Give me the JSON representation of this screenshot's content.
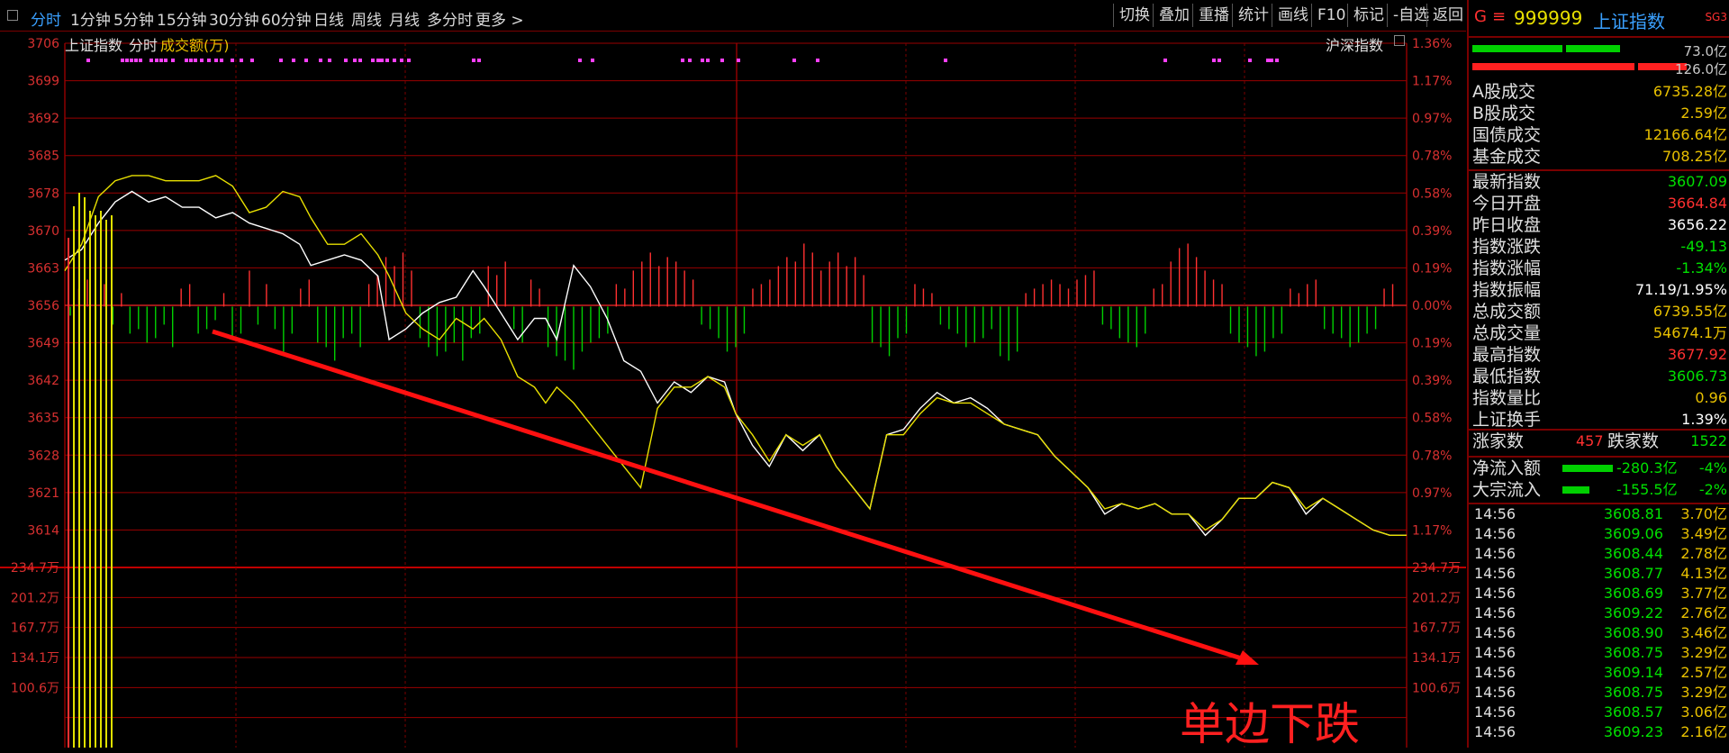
{
  "toolbar": {
    "periods": [
      "分时",
      "1分钟",
      "5分钟",
      "15分钟",
      "30分钟",
      "60分钟",
      "日线",
      "周线",
      "月线",
      "多分时",
      "更多 >"
    ],
    "right_buttons": [
      "切换",
      "叠加",
      "重播",
      "统计",
      "画线",
      "F10",
      "标记",
      "-自选",
      "返回"
    ]
  },
  "chart_header": {
    "name": "上证指数",
    "mode": "分时",
    "vol_label": "成交额(万)",
    "compare_label": "沪深指数"
  },
  "annotation": "单边下跌",
  "chart_data": {
    "type": "line",
    "left_ticks": [
      "3706",
      "3699",
      "3692",
      "3685",
      "3678",
      "3670",
      "3663",
      "3656",
      "3649",
      "3642",
      "3635",
      "3628",
      "3621",
      "3614"
    ],
    "right_ticks": [
      "1.36%",
      "1.17%",
      "0.97%",
      "0.78%",
      "0.58%",
      "0.39%",
      "0.19%",
      "0.00%",
      "0.19%",
      "0.39%",
      "0.58%",
      "0.78%",
      "0.97%",
      "1.17%"
    ],
    "vol_ticks_left": [
      "234.7万",
      "201.2万",
      "167.7万",
      "134.1万",
      "100.6万"
    ],
    "vol_ticks_right": [
      "234.7万",
      "201.2万",
      "167.7万",
      "134.1万",
      "100.6万"
    ],
    "ylim": [
      3612,
      3708
    ],
    "prev_close": 3656.22,
    "series": [
      {
        "color": "#ffffff",
        "points": [
          [
            0,
            3665
          ],
          [
            6,
            3667
          ],
          [
            12,
            3672
          ],
          [
            18,
            3676
          ],
          [
            24,
            3678
          ],
          [
            30,
            3676
          ],
          [
            36,
            3677
          ],
          [
            42,
            3675
          ],
          [
            48,
            3675
          ],
          [
            54,
            3673
          ],
          [
            60,
            3674
          ],
          [
            66,
            3672
          ],
          [
            72,
            3671
          ],
          [
            78,
            3670
          ],
          [
            84,
            3668
          ],
          [
            88,
            3664
          ],
          [
            94,
            3665
          ],
          [
            100,
            3666
          ],
          [
            106,
            3665
          ],
          [
            112,
            3662
          ],
          [
            116,
            3650
          ],
          [
            122,
            3652
          ],
          [
            128,
            3655
          ],
          [
            134,
            3657
          ],
          [
            140,
            3658
          ],
          [
            146,
            3663
          ],
          [
            150,
            3660
          ],
          [
            156,
            3655
          ],
          [
            162,
            3650
          ],
          [
            168,
            3654
          ],
          [
            172,
            3654
          ],
          [
            176,
            3650
          ],
          [
            182,
            3664
          ],
          [
            188,
            3660
          ],
          [
            194,
            3654
          ],
          [
            200,
            3646
          ],
          [
            206,
            3644
          ],
          [
            212,
            3638
          ],
          [
            218,
            3642
          ],
          [
            224,
            3640
          ],
          [
            230,
            3643
          ],
          [
            236,
            3642
          ],
          [
            240,
            3636
          ],
          [
            246,
            3630
          ],
          [
            252,
            3626
          ],
          [
            258,
            3632
          ],
          [
            264,
            3629
          ],
          [
            270,
            3632
          ],
          [
            276,
            3626
          ],
          [
            282,
            3622
          ],
          [
            288,
            3618
          ],
          [
            294,
            3632
          ],
          [
            300,
            3633
          ],
          [
            306,
            3637
          ],
          [
            312,
            3640
          ],
          [
            318,
            3638
          ],
          [
            324,
            3639
          ],
          [
            330,
            3637
          ],
          [
            336,
            3634
          ],
          [
            342,
            3633
          ],
          [
            348,
            3632
          ],
          [
            354,
            3628
          ],
          [
            360,
            3625
          ],
          [
            366,
            3622
          ],
          [
            372,
            3617
          ],
          [
            378,
            3619
          ],
          [
            384,
            3618
          ],
          [
            390,
            3619
          ],
          [
            396,
            3617
          ],
          [
            402,
            3617
          ],
          [
            408,
            3613
          ],
          [
            414,
            3616
          ],
          [
            420,
            3620
          ],
          [
            426,
            3620
          ],
          [
            432,
            3623
          ],
          [
            438,
            3622
          ],
          [
            444,
            3617
          ],
          [
            450,
            3620
          ],
          [
            456,
            3618
          ],
          [
            462,
            3616
          ],
          [
            468,
            3614
          ],
          [
            474,
            3613
          ],
          [
            480,
            3613
          ]
        ]
      },
      {
        "color": "#e8e000",
        "points": [
          [
            0,
            3663
          ],
          [
            6,
            3668
          ],
          [
            12,
            3677
          ],
          [
            18,
            3680
          ],
          [
            24,
            3681
          ],
          [
            30,
            3681
          ],
          [
            36,
            3680
          ],
          [
            42,
            3680
          ],
          [
            48,
            3680
          ],
          [
            54,
            3681
          ],
          [
            60,
            3679
          ],
          [
            66,
            3674
          ],
          [
            72,
            3675
          ],
          [
            78,
            3678
          ],
          [
            84,
            3677
          ],
          [
            88,
            3673
          ],
          [
            94,
            3668
          ],
          [
            100,
            3668
          ],
          [
            106,
            3670
          ],
          [
            112,
            3666
          ],
          [
            116,
            3662
          ],
          [
            122,
            3655
          ],
          [
            128,
            3652
          ],
          [
            134,
            3650
          ],
          [
            140,
            3654
          ],
          [
            146,
            3652
          ],
          [
            150,
            3654
          ],
          [
            156,
            3650
          ],
          [
            162,
            3643
          ],
          [
            168,
            3641
          ],
          [
            172,
            3638
          ],
          [
            176,
            3641
          ],
          [
            182,
            3638
          ],
          [
            188,
            3634
          ],
          [
            194,
            3630
          ],
          [
            200,
            3626
          ],
          [
            206,
            3622
          ],
          [
            212,
            3637
          ],
          [
            218,
            3641
          ],
          [
            224,
            3641
          ],
          [
            230,
            3643
          ],
          [
            236,
            3641
          ],
          [
            240,
            3636
          ],
          [
            246,
            3632
          ],
          [
            252,
            3627
          ],
          [
            258,
            3632
          ],
          [
            264,
            3630
          ],
          [
            270,
            3632
          ],
          [
            276,
            3626
          ],
          [
            282,
            3622
          ],
          [
            288,
            3618
          ],
          [
            294,
            3632
          ],
          [
            300,
            3632
          ],
          [
            306,
            3636
          ],
          [
            312,
            3639
          ],
          [
            318,
            3638
          ],
          [
            324,
            3638
          ],
          [
            330,
            3636
          ],
          [
            336,
            3634
          ],
          [
            342,
            3633
          ],
          [
            348,
            3632
          ],
          [
            354,
            3628
          ],
          [
            360,
            3625
          ],
          [
            366,
            3622
          ],
          [
            372,
            3618
          ],
          [
            378,
            3619
          ],
          [
            384,
            3618
          ],
          [
            390,
            3619
          ],
          [
            396,
            3617
          ],
          [
            402,
            3617
          ],
          [
            408,
            3614
          ],
          [
            414,
            3616
          ],
          [
            420,
            3620
          ],
          [
            426,
            3620
          ],
          [
            432,
            3623
          ],
          [
            438,
            3622
          ],
          [
            444,
            3618
          ],
          [
            450,
            3620
          ],
          [
            456,
            3618
          ],
          [
            462,
            3616
          ],
          [
            468,
            3614
          ],
          [
            474,
            3613
          ],
          [
            480,
            3613
          ]
        ]
      }
    ],
    "volume_bars": [
      -2,
      4,
      6,
      -3,
      5,
      -4,
      3,
      -6,
      -5,
      -8,
      -7,
      -4,
      -9,
      4,
      5,
      -6,
      -5,
      -3,
      3,
      -7,
      -6,
      8,
      -4,
      5,
      -5,
      -10,
      -6,
      4,
      6,
      -8,
      -9,
      -12,
      -7,
      -6,
      -9,
      5,
      7,
      11,
      9,
      12,
      8,
      -7,
      -9,
      -11,
      -10,
      -8,
      -12,
      -7,
      -6,
      9,
      7,
      10,
      -5,
      -8,
      6,
      4,
      -9,
      -11,
      -12,
      -14,
      -10,
      -8,
      -7,
      -6,
      5,
      4,
      8,
      10,
      12,
      9,
      11,
      10,
      8,
      6,
      -4,
      -5,
      -7,
      -10,
      -9,
      -6,
      4,
      5,
      6,
      9,
      11,
      10,
      14,
      12,
      8,
      10,
      12,
      9,
      11,
      7,
      -8,
      -9,
      -11,
      -7,
      -6,
      5,
      4,
      3,
      -4,
      -5,
      -6,
      -9,
      -8,
      -7,
      -5,
      -11,
      -12,
      -10,
      3,
      4,
      5,
      6,
      5,
      4,
      6,
      7,
      8,
      -4,
      -5,
      -7,
      -8,
      -9,
      -6,
      4,
      5,
      10,
      13,
      14,
      11,
      8,
      6,
      5,
      -6,
      -8,
      -9,
      -11,
      -10,
      -7,
      -6,
      4,
      3,
      5,
      6,
      -5,
      -6,
      -7,
      -9,
      -8,
      -6,
      -5,
      4,
      5
    ]
  },
  "side_panel": {
    "code": "999999",
    "name": "上证指数",
    "sg_label": "SG3",
    "g_label": "G",
    "bar_top_value": "73.0亿",
    "bar_bottom_value": "126.0亿",
    "turnover": [
      {
        "k": "A股成交",
        "v": "6735.28亿"
      },
      {
        "k": "B股成交",
        "v": "2.59亿"
      },
      {
        "k": "国债成交",
        "v": "12166.64亿"
      },
      {
        "k": "基金成交",
        "v": "708.25亿"
      }
    ],
    "stats": [
      {
        "k": "最新指数",
        "v": "3607.09",
        "c": "#00e000"
      },
      {
        "k": "今日开盘",
        "v": "3664.84",
        "c": "#ff3030"
      },
      {
        "k": "昨日收盘",
        "v": "3656.22",
        "c": "#ffffff"
      },
      {
        "k": "指数涨跌",
        "v": "-49.13",
        "c": "#00e000"
      },
      {
        "k": "指数涨幅",
        "v": "-1.34%",
        "c": "#00e000"
      },
      {
        "k": "指数振幅",
        "v": "71.19/1.95%",
        "c": "#ffffff"
      },
      {
        "k": "总成交额",
        "v": "6739.55亿",
        "c": "#e8c000"
      },
      {
        "k": "总成交量",
        "v": "54674.1万",
        "c": "#e8c000"
      },
      {
        "k": "最高指数",
        "v": "3677.92",
        "c": "#ff3030"
      },
      {
        "k": "最低指数",
        "v": "3606.73",
        "c": "#00e000"
      },
      {
        "k": "指数量比",
        "v": "0.96",
        "c": "#e8c000"
      },
      {
        "k": "上证换手",
        "v": "1.39%",
        "c": "#ffffff"
      }
    ],
    "breadth": {
      "up_label": "涨家数",
      "up": "457",
      "down_label": "跌家数",
      "down": "1522"
    },
    "flows": [
      {
        "k": "净流入额",
        "v": "-280.3亿",
        "p": "-4%"
      },
      {
        "k": "大宗流入",
        "v": "-155.5亿",
        "p": "-2%"
      }
    ],
    "ticks": [
      {
        "t": "14:56",
        "p": "3608.81",
        "a": "3.70亿"
      },
      {
        "t": "14:56",
        "p": "3609.06",
        "a": "3.49亿"
      },
      {
        "t": "14:56",
        "p": "3608.44",
        "a": "2.78亿"
      },
      {
        "t": "14:56",
        "p": "3608.77",
        "a": "4.13亿"
      },
      {
        "t": "14:56",
        "p": "3608.69",
        "a": "3.77亿"
      },
      {
        "t": "14:56",
        "p": "3609.22",
        "a": "2.76亿"
      },
      {
        "t": "14:56",
        "p": "3608.90",
        "a": "3.46亿"
      },
      {
        "t": "14:56",
        "p": "3608.75",
        "a": "3.29亿"
      },
      {
        "t": "14:56",
        "p": "3609.14",
        "a": "2.57亿"
      },
      {
        "t": "14:56",
        "p": "3608.75",
        "a": "3.29亿"
      },
      {
        "t": "14:56",
        "p": "3608.57",
        "a": "3.06亿"
      },
      {
        "t": "14:56",
        "p": "3609.23",
        "a": "2.16亿"
      }
    ]
  }
}
